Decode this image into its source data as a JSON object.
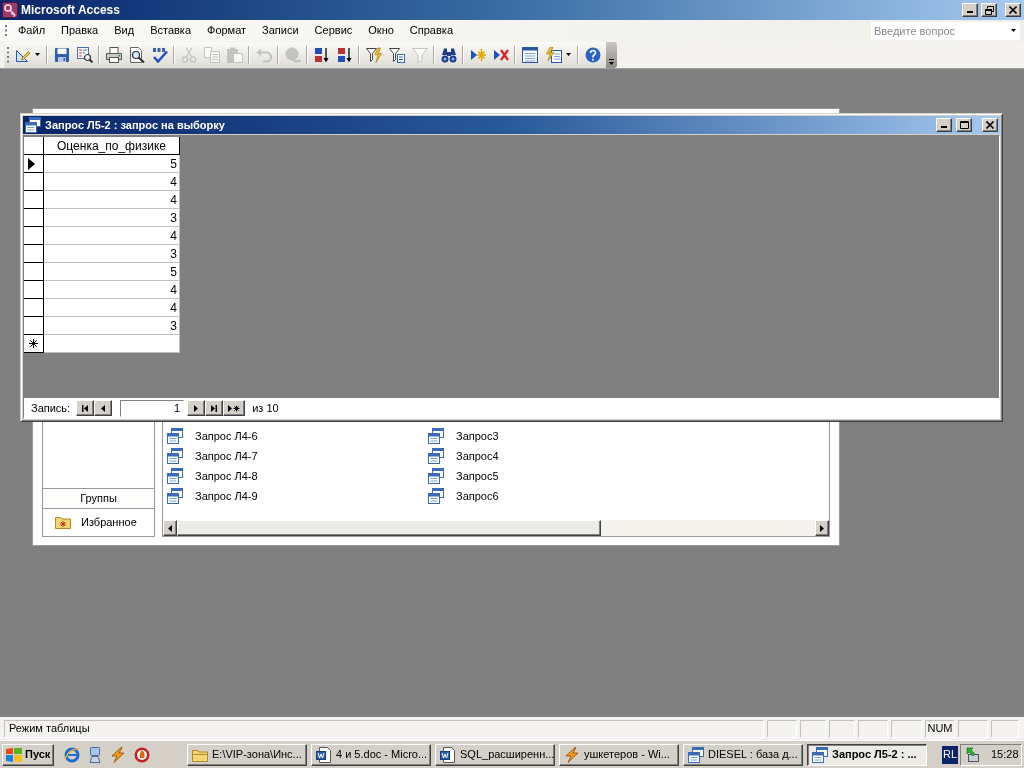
{
  "app_window": {
    "title": "Microsoft Access"
  },
  "menu_bar": [
    "Файл",
    "Правка",
    "Вид",
    "Вставка",
    "Формат",
    "Записи",
    "Сервис",
    "Окно",
    "Справка"
  ],
  "question_box": {
    "placeholder": "Введите вопрос"
  },
  "toolbar": [
    {
      "kind": "view",
      "dropdown": true,
      "disabled": false
    },
    {
      "kind": "separator"
    },
    {
      "kind": "save",
      "dropdown": false,
      "disabled": false
    },
    {
      "kind": "search",
      "dropdown": false,
      "disabled": false
    },
    {
      "kind": "separator"
    },
    {
      "kind": "print",
      "dropdown": false,
      "disabled": false
    },
    {
      "kind": "preview",
      "dropdown": false,
      "disabled": false
    },
    {
      "kind": "spelling",
      "dropdown": false,
      "disabled": false
    },
    {
      "kind": "separator"
    },
    {
      "kind": "cut",
      "dropdown": false,
      "disabled": true
    },
    {
      "kind": "copy",
      "dropdown": false,
      "disabled": true
    },
    {
      "kind": "paste",
      "dropdown": false,
      "disabled": true
    },
    {
      "kind": "separator"
    },
    {
      "kind": "undo",
      "dropdown": false,
      "disabled": true
    },
    {
      "kind": "separator"
    },
    {
      "kind": "hyperlink",
      "dropdown": false,
      "disabled": true
    },
    {
      "kind": "separator"
    },
    {
      "kind": "sortup",
      "dropdown": false,
      "disabled": false
    },
    {
      "kind": "sortdown",
      "dropdown": false,
      "disabled": false
    },
    {
      "kind": "separator"
    },
    {
      "kind": "selectionfilter",
      "dropdown": false,
      "disabled": false
    },
    {
      "kind": "formfilter",
      "dropdown": false,
      "disabled": false
    },
    {
      "kind": "applyfilter",
      "dropdown": false,
      "disabled": true
    },
    {
      "kind": "separator"
    },
    {
      "kind": "find",
      "dropdown": false,
      "disabled": false
    },
    {
      "kind": "separator"
    },
    {
      "kind": "newrecord",
      "dropdown": false,
      "disabled": false
    },
    {
      "kind": "deleterecord",
      "dropdown": false,
      "disabled": false
    },
    {
      "kind": "separator"
    },
    {
      "kind": "dbwindow",
      "dropdown": false,
      "disabled": false
    },
    {
      "kind": "newobject",
      "dropdown": true,
      "disabled": false
    },
    {
      "kind": "separator"
    },
    {
      "kind": "help",
      "dropdown": false,
      "disabled": false
    }
  ],
  "query_window": {
    "title": "Запрос Л5-2 : запрос на выборку",
    "datasheet": {
      "columns": [
        "Оценка_по_физике"
      ],
      "rows": [
        {
          "selected": true,
          "cells": [
            "5"
          ]
        },
        {
          "selected": false,
          "cells": [
            "4"
          ]
        },
        {
          "selected": false,
          "cells": [
            "4"
          ]
        },
        {
          "selected": false,
          "cells": [
            "3"
          ]
        },
        {
          "selected": false,
          "cells": [
            "4"
          ]
        },
        {
          "selected": false,
          "cells": [
            "3"
          ]
        },
        {
          "selected": false,
          "cells": [
            "5"
          ]
        },
        {
          "selected": false,
          "cells": [
            "4"
          ]
        },
        {
          "selected": false,
          "cells": [
            "4"
          ]
        },
        {
          "selected": false,
          "cells": [
            "3"
          ]
        }
      ],
      "new_record_row": true
    },
    "navigator": {
      "label": "Запись:",
      "current": "1",
      "total": "из 10"
    }
  },
  "database_window": {
    "groups_bar": "Группы",
    "groups": [
      {
        "label": "Избранное"
      }
    ],
    "objects": [
      {
        "label": "Запрос Л4-6"
      },
      {
        "label": "Запрос Л4-7"
      },
      {
        "label": "Запрос Л4-8"
      },
      {
        "label": "Запрос Л4-9"
      },
      {
        "label": "Запрос3"
      },
      {
        "label": "Запрос4"
      },
      {
        "label": "Запрос5"
      },
      {
        "label": "Запрос6"
      }
    ]
  },
  "status_bar": {
    "text": "Режим таблицы",
    "indicators": [
      "NUM"
    ]
  },
  "taskbar": {
    "start": "Пуск",
    "tasks": [
      {
        "kind": "folder",
        "label": "E:\\VIP-зона\\Инс...",
        "selected": false
      },
      {
        "kind": "document",
        "label": "4 и 5.doc - Micro...",
        "selected": false
      },
      {
        "kind": "document",
        "label": "SQL_расширенн...",
        "selected": false
      },
      {
        "kind": "player",
        "label": "ушкетеров - Wi...",
        "selected": false
      },
      {
        "kind": "database",
        "label": "DIESEL : база д...",
        "selected": false
      },
      {
        "kind": "query",
        "label": "Запрос Л5-2 : ...",
        "selected": true
      }
    ],
    "language": "RL",
    "clock": "15:28"
  }
}
